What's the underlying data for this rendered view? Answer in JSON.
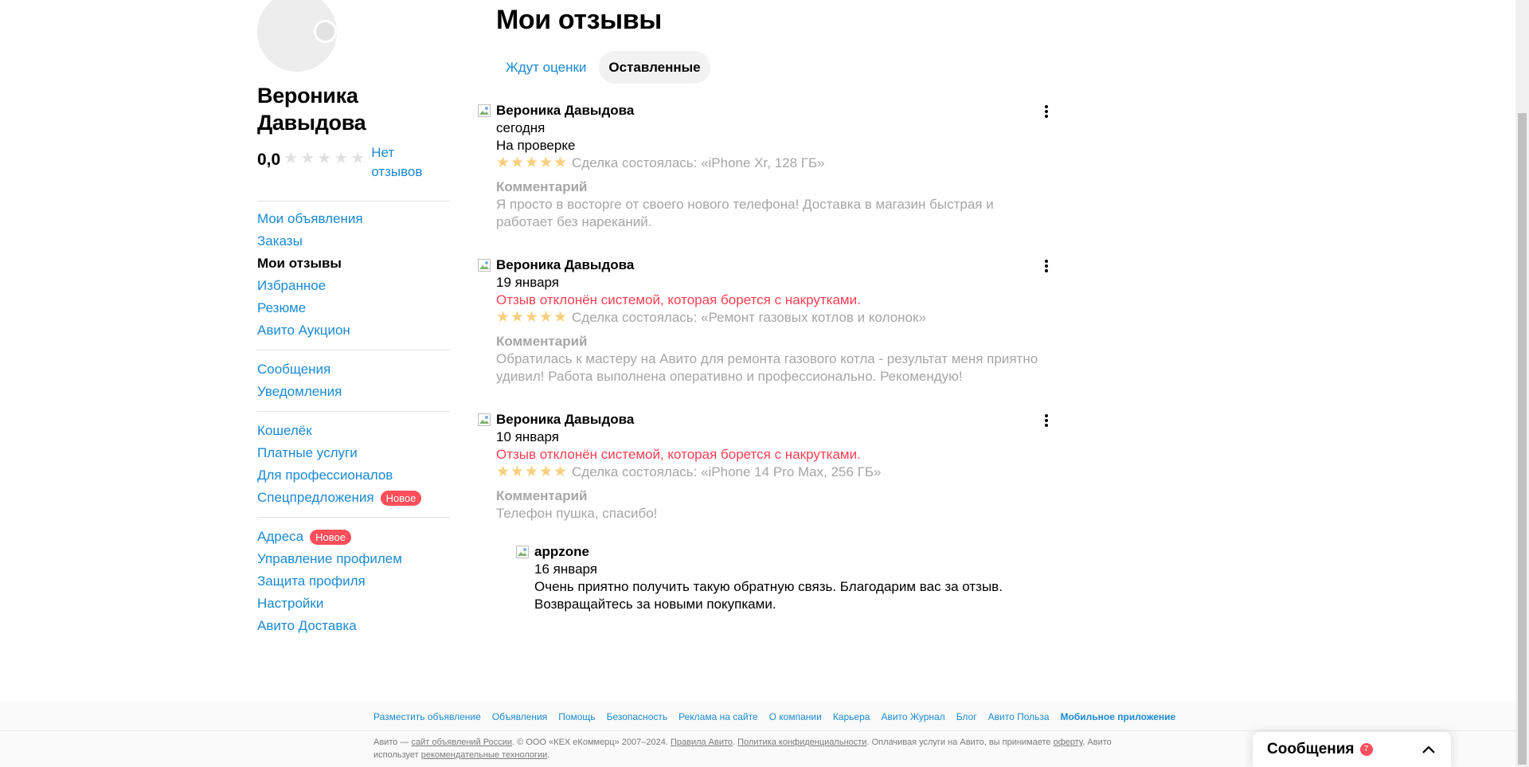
{
  "profile": {
    "name": "Вероника Давыдова",
    "rating": "0,0",
    "no_reviews": "Нет отзывов"
  },
  "sidebar": {
    "groups": [
      [
        {
          "label": "Мои объявления"
        },
        {
          "label": "Заказы"
        },
        {
          "label": "Мои отзывы",
          "active": true
        },
        {
          "label": "Избранное"
        },
        {
          "label": "Резюме"
        },
        {
          "label": "Авито Аукцион"
        }
      ],
      [
        {
          "label": "Сообщения"
        },
        {
          "label": "Уведомления"
        }
      ],
      [
        {
          "label": "Кошелёк"
        },
        {
          "label": "Платные услуги"
        },
        {
          "label": "Для профессионалов"
        },
        {
          "label": "Спецпредложения",
          "badge": "Новое"
        }
      ],
      [
        {
          "label": "Адреса",
          "badge": "Новое"
        },
        {
          "label": "Управление профилем"
        },
        {
          "label": "Защита профиля"
        },
        {
          "label": "Настройки"
        },
        {
          "label": "Авито Доставка"
        }
      ]
    ]
  },
  "main": {
    "title": "Мои отзывы",
    "tabs": [
      {
        "label": "Ждут оценки",
        "active": false
      },
      {
        "label": "Оставленные",
        "active": true
      }
    ],
    "reviews": [
      {
        "author": "Вероника Давыдова",
        "date": "сегодня",
        "status": "На проверке",
        "status_red": false,
        "deal": "Сделка состоялась: «iPhone Xr, 128 ГБ»",
        "comment_title": "Комментарий",
        "comment": "Я просто в восторге от своего нового телефона! Доставка в магазин быстрая и работает без нареканий."
      },
      {
        "author": "Вероника Давыдова",
        "date": "19 января",
        "status": "Отзыв отклонён системой, которая борется с накрутками.",
        "status_red": true,
        "deal": "Сделка состоялась: «Ремонт газовых котлов и колонок»",
        "comment_title": "Комментарий",
        "comment": "Обратилась к мастеру на Авито для ремонта газового котла - результат меня приятно удивил! Работа выполнена оперативно и профессионально. Рекомендую!"
      },
      {
        "author": "Вероника Давыдова",
        "date": "10 января",
        "status": "Отзыв отклонён системой, которая борется с накрутками.",
        "status_red": true,
        "deal": "Сделка состоялась: «iPhone 14 Pro Max, 256 ГБ»",
        "comment_title": "Комментарий",
        "comment": "Телефон пушка, спасибо!",
        "reply": {
          "author": "appzone",
          "date": "16 января",
          "text": "Очень приятно получить такую обратную связь. Благодарим вас за отзыв. Возвращайтесь за новыми покупками."
        }
      }
    ]
  },
  "footer": {
    "links": [
      {
        "label": "Разместить объявление"
      },
      {
        "label": "Объявления"
      },
      {
        "label": "Помощь"
      },
      {
        "label": "Безопасность"
      },
      {
        "label": "Реклама на сайте"
      },
      {
        "label": "О компании"
      },
      {
        "label": "Карьера"
      },
      {
        "label": "Авито Журнал"
      },
      {
        "label": "Блог"
      },
      {
        "label": "Авито Польза"
      },
      {
        "label": "Мобильное приложение",
        "bold": true
      }
    ],
    "legal_parts": [
      {
        "t": "Авито — ",
        "u": false
      },
      {
        "t": "сайт объявлений России",
        "u": true
      },
      {
        "t": ". © ООО «КЕХ еКоммерц» 2007–2024. ",
        "u": false
      },
      {
        "t": "Правила Авито",
        "u": true
      },
      {
        "t": ". ",
        "u": false
      },
      {
        "t": "Политика конфиденциальности",
        "u": true
      },
      {
        "t": ". Оплачивая услуги на Авито, вы принимаете ",
        "u": false
      },
      {
        "t": "оферту",
        "u": true
      },
      {
        "t": ". Авито использует ",
        "u": false
      },
      {
        "t": "рекомендательные технологии",
        "u": true
      },
      {
        "t": ".",
        "u": false
      }
    ]
  },
  "messages_widget": {
    "title": "Сообщения",
    "count": "7"
  },
  "colors": {
    "link": "#1a8ad4",
    "error": "#ff4053",
    "badge": "#ff4f5a",
    "star_filled": "#f8cf7d"
  }
}
